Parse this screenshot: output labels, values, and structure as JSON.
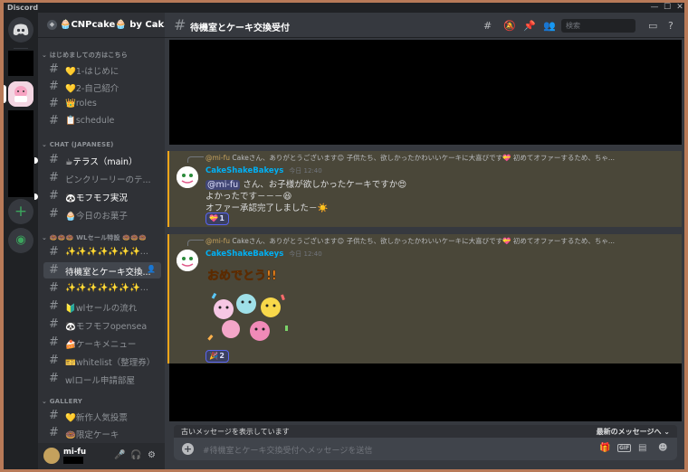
{
  "window": {
    "app_name": "Discord",
    "minimize": "—",
    "maximize": "☐",
    "close": "✕"
  },
  "server": {
    "name": "🧁CNPcake🧁 by Cak…",
    "chevron": "⌄"
  },
  "sidebar": {
    "categories": [
      {
        "label": "はじめましての方はこちら"
      },
      {
        "label": "CHAT (JAPANESE)"
      },
      {
        "label": "🍩🍩🍩 WLセール特設 🍩🍩🍩"
      },
      {
        "label": "GALLERY"
      }
    ],
    "channels": [
      {
        "label": "💛1-はじめに",
        "state": "normal"
      },
      {
        "label": "💛2-自己紹介",
        "state": "normal"
      },
      {
        "label": "👑roles",
        "state": "normal"
      },
      {
        "label": "📋schedule",
        "state": "normal"
      },
      {
        "label": "☕テラス（main）",
        "state": "unread"
      },
      {
        "label": "ピンクリーリーのテ...",
        "state": "normal"
      },
      {
        "label": "🐼モフモフ実況",
        "state": "unread"
      },
      {
        "label": "🧁今日のお菓子",
        "state": "normal"
      },
      {
        "label": "✨✨✨✨✨✨✨...",
        "state": "normal"
      },
      {
        "label": "待機室とケーキ交換...",
        "state": "active"
      },
      {
        "label": "✨✨✨✨✨✨✨...",
        "state": "normal"
      },
      {
        "label": "🔰wlセールの流れ",
        "state": "normal"
      },
      {
        "label": "🐼モフモフopensea",
        "state": "normal"
      },
      {
        "label": "🍰ケーキメニュー",
        "state": "normal"
      },
      {
        "label": "🎫whitelist（整理券）",
        "state": "normal"
      },
      {
        "label": "wlロール申請部屋",
        "state": "normal"
      },
      {
        "label": "💛新作人気投票",
        "state": "normal"
      },
      {
        "label": "🍩限定ケーキ",
        "state": "normal"
      }
    ]
  },
  "user": {
    "name": "mi-fu"
  },
  "channel": {
    "title": "待機室とケーキ交換受付",
    "search_placeholder": "検索"
  },
  "messages": [
    {
      "reply_who": "@mi-fu",
      "reply_text": "Cakeさん、ありがとうございます😊 子供たち、欲しかったかわいいケーキに大喜びです💝 初めてオファーするため、ちゃ...",
      "author": "CakeShakeBakeys",
      "time": "今日 12:40",
      "mention": "@mi-fu",
      "line1": " さん、お子様が欲しかったケーキですか😍",
      "line2": "よかったです－－－😆",
      "line3": "オファー承認完了しました－☀️",
      "reaction_emoji": "💝",
      "reaction_count": "1"
    },
    {
      "reply_who": "@mi-fu",
      "reply_text": "Cakeさん、ありがとうございます😊 子供たち、欲しかったかわいいケーキに大喜びです💝 初めてオファーするため、ちゃ...",
      "author": "CakeShakeBakeys",
      "time": "今日 12:40",
      "sticker_text": "おめでとう!!",
      "reaction_emoji": "🎉",
      "reaction_count": "2"
    }
  ],
  "composer": {
    "older_notice": "古いメッセージを表示しています",
    "jump_latest": "最新のメッセージへ ⌄",
    "placeholder": "#待機室とケーキ交換受付へメッセージを送信",
    "gif_label": "GIF"
  },
  "icons": [
    "discord-logo-icon",
    "add-server-icon",
    "explore-icon",
    "threads-icon",
    "mute-icon",
    "pin-icon",
    "members-icon",
    "inbox-icon",
    "help-icon",
    "mic-icon",
    "headphones-icon",
    "settings-icon",
    "gift-icon",
    "sticker-icon",
    "emoji-icon"
  ],
  "colors": {
    "accent": "#5865f2",
    "highlight_border": "#faa61a",
    "author": "#00b0f4",
    "green": "#3ba55d"
  }
}
